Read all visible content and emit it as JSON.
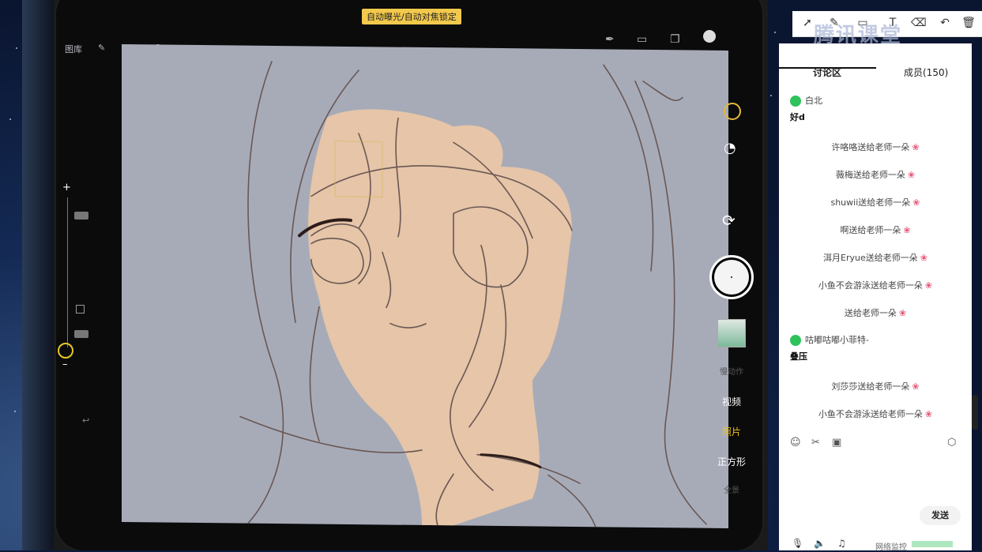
{
  "camera": {
    "banner": "自动曝光/自动对焦锁定",
    "modes": [
      "视频",
      "照片",
      "正方形"
    ],
    "active_mode": "照片",
    "faded_top_mode": "慢动作",
    "faded_bottom_mode": "全景"
  },
  "procreate": {
    "gallery_label": "图库"
  },
  "annotation_toolbar": {
    "icons": [
      "pointer-icon",
      "pen-icon",
      "rectangle-icon",
      "text-icon",
      "eraser-icon",
      "undo-icon",
      "trash-icon"
    ]
  },
  "brand_text": "腾讯课堂",
  "chat": {
    "tabs": [
      {
        "label": "讨论区",
        "active": true
      },
      {
        "label": "成员(150)",
        "active": false
      }
    ],
    "messages": [
      {
        "type": "user",
        "user": "白北",
        "text": "好d"
      },
      {
        "type": "gift",
        "text": "许咯咯送给老师一朵"
      },
      {
        "type": "gift",
        "text": "薇梅送给老师一朵"
      },
      {
        "type": "gift",
        "text": "shuwii送给老师一朵"
      },
      {
        "type": "gift",
        "text": "啊送给老师一朵"
      },
      {
        "type": "gift",
        "text": "洱月Eryue送给老师一朵"
      },
      {
        "type": "gift",
        "text": "小鱼不会游泳送给老师一朵"
      },
      {
        "type": "gift",
        "text": "送给老师一朵"
      },
      {
        "type": "user",
        "user": "咕嘟咕嘟小菲特-",
        "text": "叠压"
      },
      {
        "type": "gift",
        "text": "刘莎莎送给老师一朵"
      },
      {
        "type": "gift",
        "text": "小鱼不会游泳送给老师一朵"
      }
    ],
    "send_label": "发送",
    "network_label": "网络监控",
    "colors": {
      "wechat_green": "#2ec25b",
      "flower": "#e9587a"
    }
  }
}
